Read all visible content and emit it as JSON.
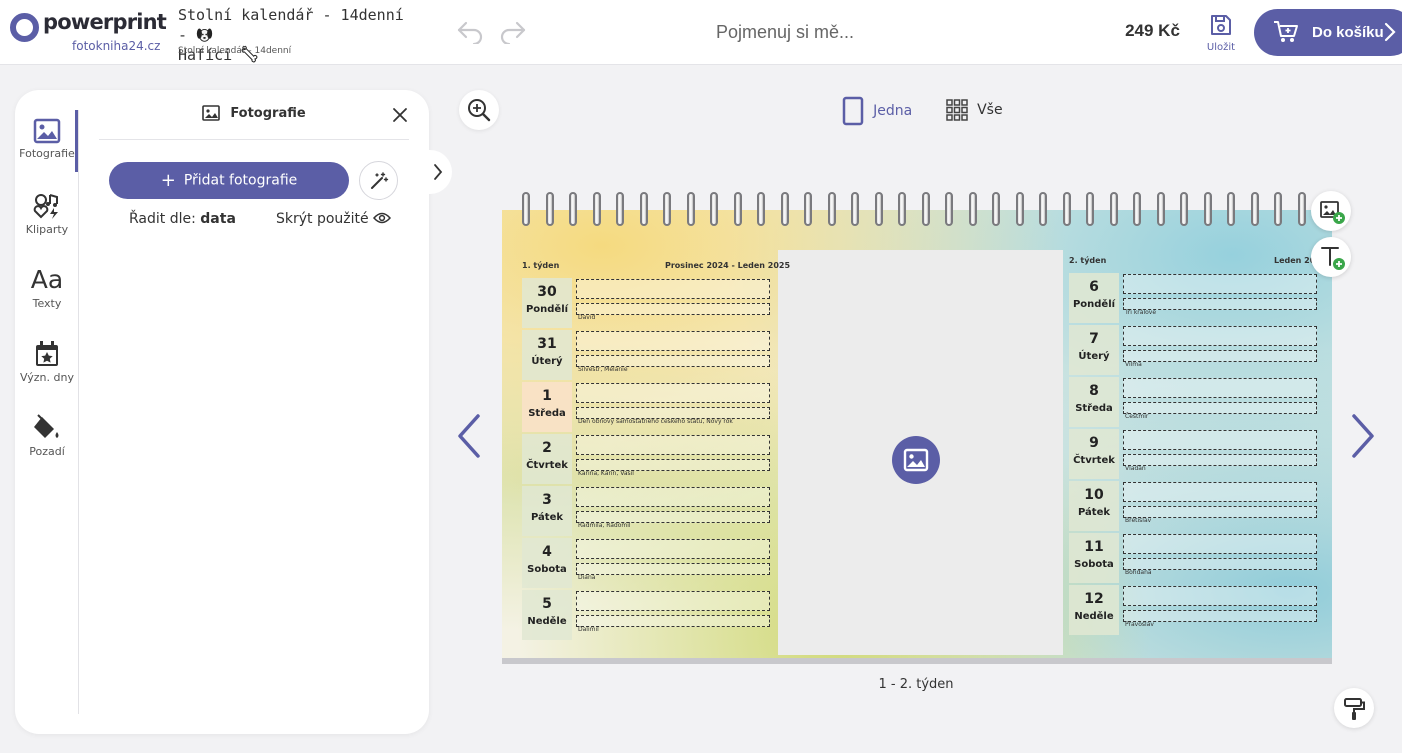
{
  "header": {
    "logo_text": "powerprint",
    "logo_sub": "fotokniha24.cz",
    "title_line1": "Stolní kalendář - 14denní -",
    "title_line2": "Hafíci",
    "subtitle": "Stolní kalendář - 14denní",
    "name_placeholder": "Pojmenuj si mě...",
    "price": "249 Kč",
    "save_label": "Uložit",
    "cart_label": "Do košíku"
  },
  "rail": {
    "items": [
      {
        "label": "Fotografie",
        "icon": "image-icon",
        "active": true
      },
      {
        "label": "Kliparty",
        "icon": "cliparts-icon"
      },
      {
        "label": "Texty",
        "icon": "text-icon"
      },
      {
        "label": "Význ. dny",
        "icon": "calendar-star-icon"
      },
      {
        "label": "Pozadí",
        "icon": "paint-bucket-icon"
      }
    ]
  },
  "panel": {
    "title": "Fotografie",
    "add_photos": "Přidat fotografie",
    "sort_label": "Řadit dle:",
    "sort_value": "data",
    "hide_used": "Skrýt použité"
  },
  "view": {
    "single": "Jedna",
    "all": "Vše"
  },
  "colors": {
    "accent": "#5b5ea6"
  },
  "calendar": {
    "left": {
      "week": "1. týden",
      "range": "Prosinec 2024 - Leden 2025",
      "days": [
        {
          "num": "30",
          "name": "Pondělí",
          "nameday": "David"
        },
        {
          "num": "31",
          "name": "Úterý",
          "nameday": "Silvestr, Melanie"
        },
        {
          "num": "1",
          "name": "Středa",
          "nameday": "Den obnovy samostatného českého státu, Nový rok",
          "holiday": true
        },
        {
          "num": "2",
          "name": "Čtvrtek",
          "nameday": "Karina, Karin, Vasil"
        },
        {
          "num": "3",
          "name": "Pátek",
          "nameday": "Radmila, Radomil"
        },
        {
          "num": "4",
          "name": "Sobota",
          "nameday": "Diana"
        },
        {
          "num": "5",
          "name": "Neděle",
          "nameday": "Dalimil"
        }
      ]
    },
    "right": {
      "week": "2. týden",
      "range": "Leden 2025",
      "days": [
        {
          "num": "6",
          "name": "Pondělí",
          "nameday": "Tři králové"
        },
        {
          "num": "7",
          "name": "Úterý",
          "nameday": "Vilma"
        },
        {
          "num": "8",
          "name": "Středa",
          "nameday": "Čestmír"
        },
        {
          "num": "9",
          "name": "Čtvrtek",
          "nameday": "Vladan"
        },
        {
          "num": "10",
          "name": "Pátek",
          "nameday": "Břetislav"
        },
        {
          "num": "11",
          "name": "Sobota",
          "nameday": "Bohdana"
        },
        {
          "num": "12",
          "name": "Neděle",
          "nameday": "Pravoslav"
        }
      ]
    },
    "page_label": "1 - 2. týden"
  }
}
